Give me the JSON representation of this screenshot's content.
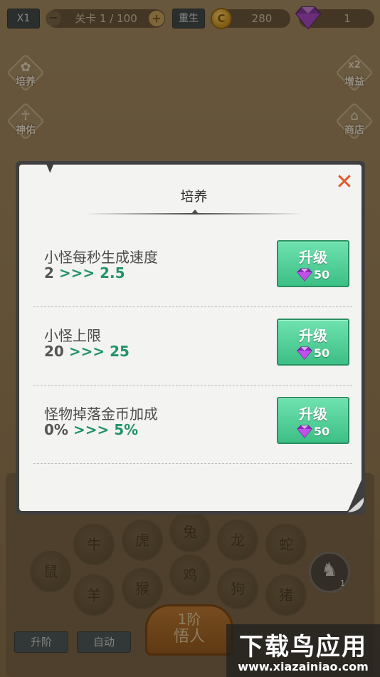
{
  "topbar": {
    "speed_label": "X1",
    "level_label": "关卡 1 / 100",
    "rebirth_label": "重生",
    "coin_symbol": "C",
    "coin_count": "280",
    "gem_count": "1"
  },
  "side_menu": {
    "left": [
      {
        "label": "培养"
      },
      {
        "label": "神佑"
      }
    ],
    "right": [
      {
        "label": "增益",
        "badge": "x2"
      },
      {
        "label": "商店"
      }
    ]
  },
  "game": {
    "zodiac": [
      "牛",
      "虎",
      "兔",
      "龙",
      "蛇",
      "鼠",
      "羊",
      "猴",
      "鸡",
      "狗",
      "猪"
    ],
    "rank": {
      "line1": "1阶",
      "line2": "悟人"
    },
    "upgrade_button": "升阶",
    "auto_button": "自动",
    "horse_badge": "1"
  },
  "modal": {
    "title": "培养",
    "close_symbol": "✕",
    "rows": [
      {
        "name": "小怪每秒生成速度",
        "from": "2",
        "arrow": ">>>",
        "to": "2.5",
        "button": "升级",
        "cost": "50"
      },
      {
        "name": "小怪上限",
        "from": "20",
        "arrow": ">>>",
        "to": "25",
        "button": "升级",
        "cost": "50"
      },
      {
        "name": "怪物掉落金币加成",
        "from": "0%",
        "arrow": ">>>",
        "to": "5%",
        "button": "升级",
        "cost": "50"
      }
    ]
  },
  "watermark": {
    "big": "下载鸟应用",
    "small": "www.xiazainiao.com"
  },
  "colors": {
    "accent_green": "#3cbf85",
    "value_green": "#22936a",
    "close_orange": "#e8562a",
    "gem_purple": "#a23ad1"
  }
}
